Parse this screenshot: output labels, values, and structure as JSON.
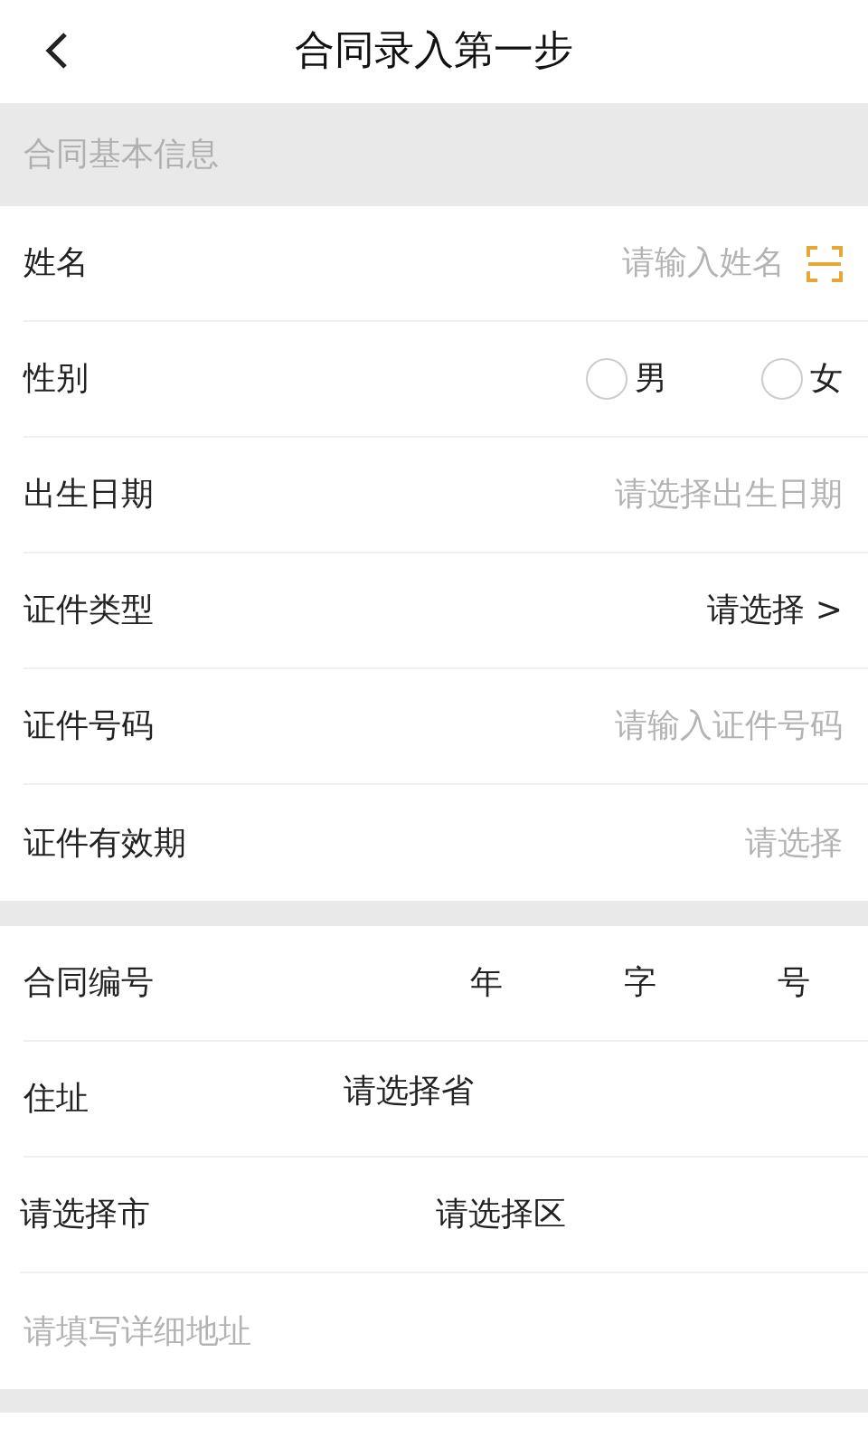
{
  "header": {
    "title": "合同录入第一步"
  },
  "section_title": "合同基本信息",
  "fields": [
    {
      "kind": "input",
      "label": "姓名",
      "placeholder": "请输入姓名",
      "scan": true
    },
    {
      "kind": "radio",
      "label": "性别",
      "options": [
        {
          "label": "男",
          "selected": false
        },
        {
          "label": "女",
          "selected": false
        }
      ]
    },
    {
      "kind": "picker",
      "label": "出生日期",
      "placeholder": "请选择出生日期"
    },
    {
      "kind": "select",
      "label": "证件类型",
      "value": "请选择 >"
    },
    {
      "kind": "input",
      "label": "证件号码",
      "placeholder": "请输入证件号码"
    },
    {
      "kind": "picker",
      "label": "证件有效期",
      "placeholder": "请选择"
    }
  ],
  "contract": {
    "label": "合同编号",
    "units": [
      "年",
      "字",
      "号"
    ]
  },
  "address": {
    "label": "住址",
    "province": "请选择省",
    "city": "请选择市",
    "district": "请选择区",
    "detail_placeholder": "请填写详细地址"
  }
}
